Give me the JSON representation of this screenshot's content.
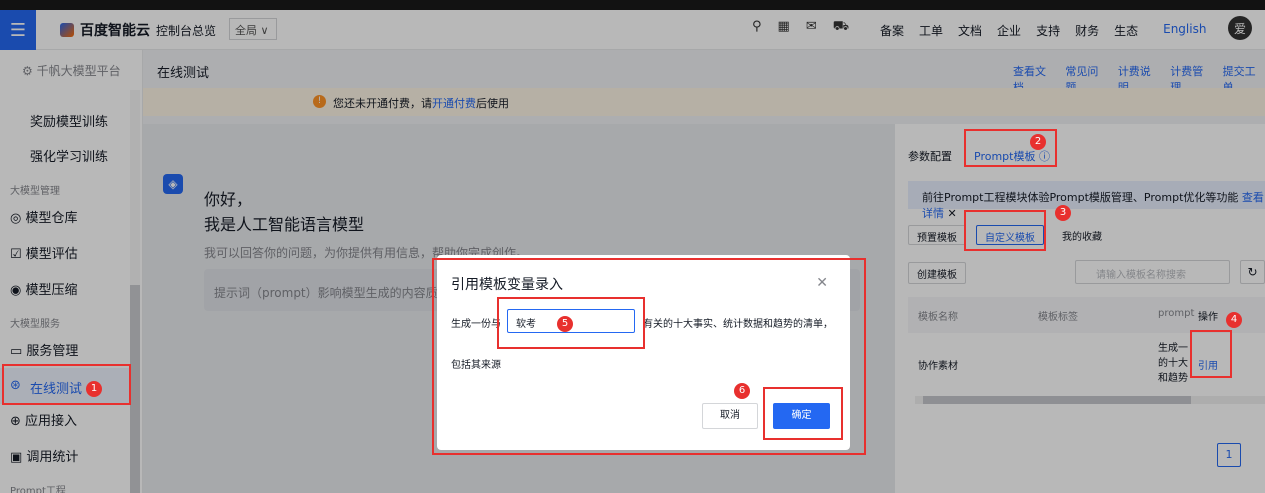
{
  "topbar": {
    "brand": "百度智能云",
    "console": "控制台总览",
    "region": "全局 ∨",
    "nav": [
      "备案",
      "工单",
      "文档",
      "企业",
      "支持",
      "财务",
      "生态"
    ],
    "lang": "English",
    "avatar": "爱"
  },
  "sidebar": {
    "platform": "千帆大模型平台",
    "items": {
      "reward": "奖励模型训练",
      "rl": "强化学习训练",
      "group1": "大模型管理",
      "repo": "模型仓库",
      "eval": "模型评估",
      "compress": "模型压缩",
      "group2": "大模型服务",
      "service": "服务管理",
      "online": "在线测试",
      "app": "应用接入",
      "stats": "调用统计",
      "group3": "Prompt工程"
    }
  },
  "main": {
    "title": "在线测试",
    "links": [
      "查看文档",
      "常见问题",
      "计费说明",
      "计费管理",
      "提交工单"
    ],
    "notice_pre": "您还未开通付费，请",
    "notice_link": "开通付费",
    "notice_post": "后使用",
    "hello1": "你好，",
    "hello2": "我是人工智能语言模型",
    "hello3": "我可以回答你的问题，为你提供有用信息，帮助你完成创作。",
    "hint": "提示词（prompt）影响模型生成的内容质量"
  },
  "right": {
    "tab_params": "参数配置",
    "tab_prompt": "Prompt模板",
    "banner": "前往Prompt工程模块体验Prompt模版管理、Prompt优化等功能",
    "banner_link": "查看详情",
    "subtab_preset": "预置模板",
    "subtab_custom": "自定义模板",
    "subtab_fav": "我的收藏",
    "create": "创建模板",
    "search_placeholder": "请输入模板名称搜索",
    "col_name": "模板名称",
    "col_tag": "模板标签",
    "col_prompt": "prompt",
    "col_op": "操作",
    "row_name": "协作素材",
    "row_prompt": "生成一 的十大 和趋势",
    "row_op": "引用",
    "page": "1"
  },
  "dialog": {
    "title": "引用模板变量录入",
    "text_before": "生成一份与",
    "input_value": "软考",
    "text_after": "有关的十大事实、统计数据和趋势的清单，",
    "text_line2": "包括其来源",
    "cancel": "取消",
    "ok": "确定"
  },
  "annotations": [
    "1",
    "2",
    "3",
    "4",
    "5",
    "6"
  ],
  "colors": {
    "accent": "#2468f2",
    "annotation": "#e8302e"
  }
}
